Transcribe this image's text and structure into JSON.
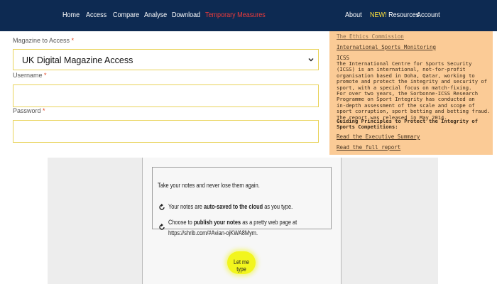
{
  "nav": {
    "left_items": [
      "Home",
      "Access",
      "Compare",
      "Analyse",
      "Download",
      "Temporary Measures"
    ],
    "active_item": "Temporary Measures",
    "right_items": [
      "About",
      "Resources",
      "Account"
    ],
    "new_badge": "NEW!",
    "colors": {
      "bar": "#0d2a52",
      "text": "#ffffff",
      "active": "#ef3b3b",
      "badge": "#ffe23b"
    }
  },
  "form": {
    "magazine_label": "Magazine to Access",
    "required_mark": "*",
    "magazine_value": "UK Digital Magazine Access",
    "username_label": "Username",
    "password_label": "Password",
    "username_value": "",
    "password_value": "",
    "field_border_color": "#e9d35a"
  },
  "info_panel": {
    "background": "#fbcb96",
    "link_ethics": "The Ethics Commission",
    "link_monitoring": "International Sports Monitoring",
    "icss_heading": "ICSS",
    "icss_body_lines": [
      "The International Centre for Sports Security",
      "(ICSS) is an international, not-for-profit",
      "organisation based in Doha, Qatar, working to",
      "promote and protect the integrity and security of",
      "sport, with a special focus on match-fixing.",
      "For over two years, the Sorbonne-ICSS Research",
      "Programme on Sport Integrity has conducted an",
      "in-depth assessment of the scale and scope of",
      "sport corruption, sport betting and betting fraud.",
      "The report was released in May 2014."
    ],
    "principles_heading": "Guiding Principles to Protect the Integrity of Sports Competitions:",
    "link_summary": "Read the Executive Summary",
    "link_full": "Read the full report"
  },
  "ad": {
    "intro": "Take your notes and never lose them again.",
    "point1_prefix": "Your notes are ",
    "point1_bold": "auto-saved to the cloud",
    "point1_suffix": " as you type.",
    "point2_prefix": "Choose to ",
    "point2_bold": "publish your notes",
    "point2_suffix": " as a pretty web page at",
    "point2_url": "https://shrib.com/#Avian-ojKWA8Mym.",
    "button_label": "Let me type",
    "button_color": "#f2f51d"
  }
}
